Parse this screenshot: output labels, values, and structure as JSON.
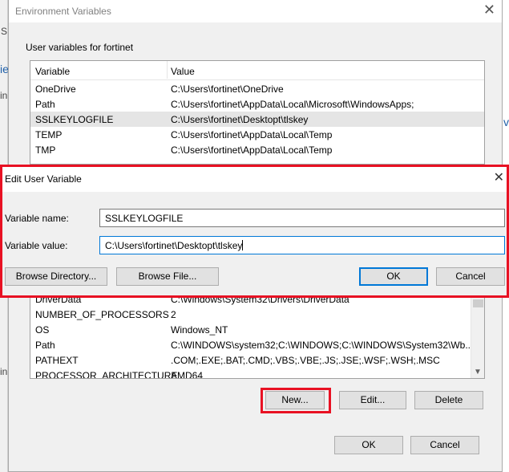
{
  "background": {
    "fragments": [
      "S",
      "ie",
      "in",
      "in",
      "v"
    ]
  },
  "env_dialog": {
    "title": "Environment Variables",
    "close_glyph": "✕",
    "user_group_label": "User variables for fortinet",
    "columns": {
      "variable": "Variable",
      "value": "Value"
    },
    "user_vars": [
      {
        "name": "OneDrive",
        "value": "C:\\Users\\fortinet\\OneDrive"
      },
      {
        "name": "Path",
        "value": "C:\\Users\\fortinet\\AppData\\Local\\Microsoft\\WindowsApps;"
      },
      {
        "name": "SSLKEYLOGFILE",
        "value": "C:\\Users\\fortinet\\Desktopt\\tlskey"
      },
      {
        "name": "TEMP",
        "value": "C:\\Users\\fortinet\\AppData\\Local\\Temp"
      },
      {
        "name": "TMP",
        "value": "C:\\Users\\fortinet\\AppData\\Local\\Temp"
      }
    ],
    "system_vars": [
      {
        "name": "DriverData",
        "value": "C:\\Windows\\System32\\Drivers\\DriverData"
      },
      {
        "name": "NUMBER_OF_PROCESSORS",
        "value": "2"
      },
      {
        "name": "OS",
        "value": "Windows_NT"
      },
      {
        "name": "Path",
        "value": "C:\\WINDOWS\\system32;C:\\WINDOWS;C:\\WINDOWS\\System32\\Wb..."
      },
      {
        "name": "PATHEXT",
        "value": ".COM;.EXE;.BAT;.CMD;.VBS;.VBE;.JS;.JSE;.WSF;.WSH;.MSC"
      },
      {
        "name": "PROCESSOR_ARCHITECTURE",
        "value": "AMD64"
      }
    ],
    "scroll_down_glyph": "▼",
    "system_buttons": {
      "new": "New...",
      "edit": "Edit...",
      "delete": "Delete"
    },
    "footer_buttons": {
      "ok": "OK",
      "cancel": "Cancel"
    }
  },
  "edit_dialog": {
    "title": "Edit User Variable",
    "close_glyph": "✕",
    "name_label": "Variable name:",
    "name_value": "SSLKEYLOGFILE",
    "value_label": "Variable value:",
    "value_value": "C:\\Users\\fortinet\\Desktopt\\tlskey",
    "buttons": {
      "browse_directory": "Browse Directory...",
      "browse_file": "Browse File...",
      "ok": "OK",
      "cancel": "Cancel"
    }
  },
  "colors": {
    "highlight": "#e81123",
    "focus": "#0078d7",
    "dialog_bg": "#f0f0f0"
  }
}
